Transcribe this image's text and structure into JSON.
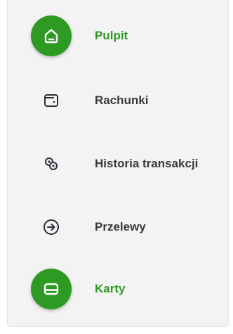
{
  "nav": {
    "items": [
      {
        "label": "Pulpit",
        "icon": "home-icon",
        "active": true
      },
      {
        "label": "Rachunki",
        "icon": "wallet-icon",
        "active": false
      },
      {
        "label": "Historia transakcji",
        "icon": "coins-icon",
        "active": false
      },
      {
        "label": "Przelewy",
        "icon": "arrow-right-circle-icon",
        "active": false
      },
      {
        "label": "Karty",
        "icon": "card-icon",
        "active": true
      }
    ]
  },
  "colors": {
    "accent": "#2e9a24",
    "text": "#3a3a3a",
    "background": "#f3f3f3",
    "icon_dark": "#2b2f3a"
  }
}
